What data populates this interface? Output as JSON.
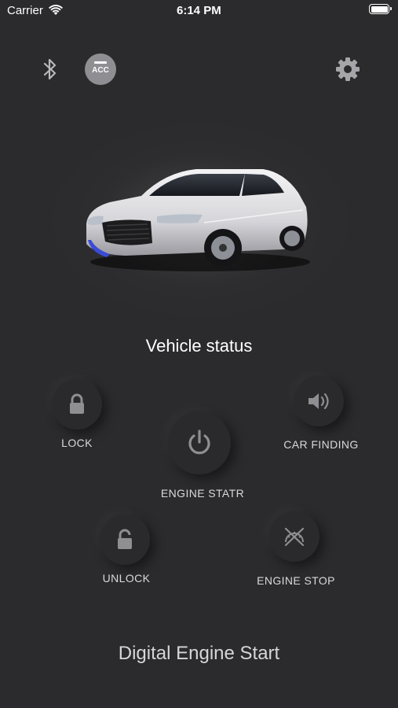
{
  "status_bar": {
    "carrier": "Carrier",
    "time": "6:14 PM"
  },
  "header": {
    "acc_label": "ACC",
    "icons": [
      "bluetooth-icon",
      "acc-icon",
      "gear-icon"
    ]
  },
  "vehicle": {
    "status_title": "Vehicle status"
  },
  "controls": {
    "lock": "LOCK",
    "car_finding": "CAR FINDING",
    "engine_start": "ENGINE STATR",
    "unlock": "UNLOCK",
    "engine_stop": "ENGINE STOP"
  },
  "footer": {
    "title": "Digital Engine Start"
  },
  "colors": {
    "background": "#2b2b2d",
    "icon_gray": "#8e8e93",
    "label": "#d9d9d9"
  }
}
